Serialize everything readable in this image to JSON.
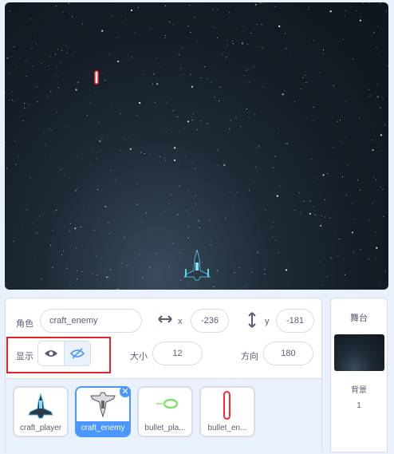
{
  "sprite_info": {
    "sprite_label": "角色",
    "sprite_name": "craft_enemy",
    "x_label": "x",
    "x_value": "-236",
    "y_label": "y",
    "y_value": "-181",
    "show_label": "显示",
    "size_label": "大小",
    "size_value": "12",
    "direction_label": "方向",
    "direction_value": "180"
  },
  "sprites": [
    {
      "name": "craft_player"
    },
    {
      "name": "craft_enemy"
    },
    {
      "name": "bullet_pla..."
    },
    {
      "name": "bullet_en..."
    }
  ],
  "stage_panel": {
    "title": "舞台",
    "backdrop_label": "背景",
    "backdrop_count": "1"
  },
  "colors": {
    "accent": "#4c97ff",
    "highlight_box": "#e0262b",
    "delete_badge": "#4c97ff"
  }
}
